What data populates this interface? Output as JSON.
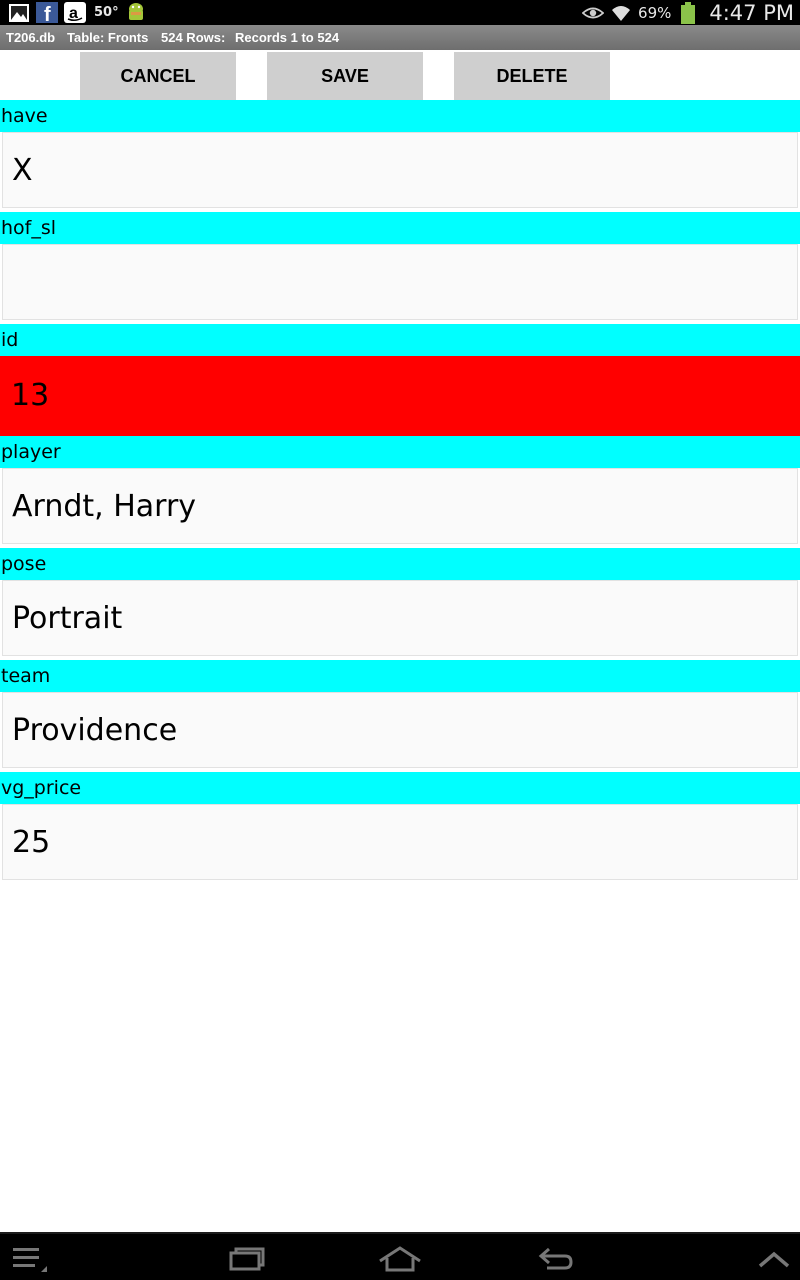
{
  "status_bar": {
    "temperature": "50°",
    "battery_percent": "69%",
    "time": "4:47 PM",
    "icons": [
      "gallery-icon",
      "facebook-icon",
      "amazon-icon",
      "android-icon",
      "eye-icon",
      "wifi-icon",
      "battery-icon"
    ]
  },
  "title_bar": {
    "db": "T206.db",
    "table": "Table:  Fronts",
    "rows": "524 Rows:",
    "records": "Records 1 to 524"
  },
  "actions": {
    "cancel": "CANCEL",
    "save": "SAVE",
    "delete": "DELETE"
  },
  "fields": [
    {
      "label": "have",
      "value": "X"
    },
    {
      "label": "hof_sl",
      "value": ""
    },
    {
      "label": "id",
      "value": "13"
    },
    {
      "label": "player",
      "value": "Arndt, Harry"
    },
    {
      "label": "pose",
      "value": "Portrait"
    },
    {
      "label": "team",
      "value": "Providence"
    },
    {
      "label": "vg_price",
      "value": "25"
    }
  ],
  "colors": {
    "label_bg": "#00ffff",
    "highlight_bg": "#ff0000",
    "button_bg": "#cfcfcf"
  },
  "nav_bar": {
    "icons": [
      "menu-icon",
      "recent-apps-icon",
      "home-icon",
      "back-icon",
      "chevron-up-icon"
    ]
  }
}
